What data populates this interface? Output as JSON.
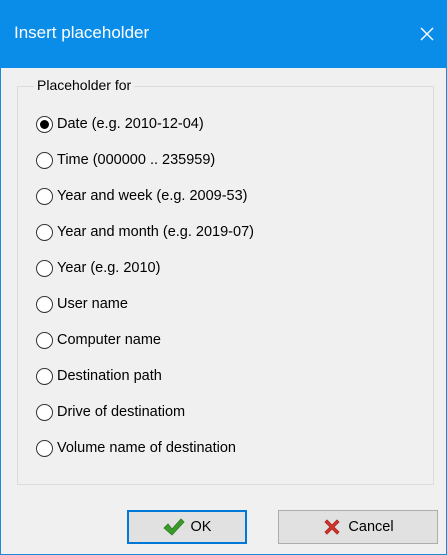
{
  "window": {
    "title": "Insert placeholder"
  },
  "group": {
    "label": "Placeholder for",
    "options": [
      {
        "label": "Date (e.g. 2010-12-04)",
        "checked": true
      },
      {
        "label": "Time (000000 .. 235959)",
        "checked": false
      },
      {
        "label": "Year and week (e.g. 2009-53)",
        "checked": false
      },
      {
        "label": "Year and month (e.g. 2019-07)",
        "checked": false
      },
      {
        "label": "Year (e.g. 2010)",
        "checked": false
      },
      {
        "label": "User name",
        "checked": false
      },
      {
        "label": "Computer name",
        "checked": false
      },
      {
        "label": "Destination path",
        "checked": false
      },
      {
        "label": "Drive of destinatiom",
        "checked": false
      },
      {
        "label": "Volume name of destination",
        "checked": false
      }
    ]
  },
  "buttons": {
    "ok_label": "OK",
    "cancel_label": "Cancel"
  },
  "icons": {
    "close": "close-icon",
    "ok": "check-icon",
    "cancel": "cross-icon"
  },
  "colors": {
    "titlebar": "#0a8de8",
    "ok_check": "#3a9a2a",
    "cancel_x": "#d0342c"
  }
}
